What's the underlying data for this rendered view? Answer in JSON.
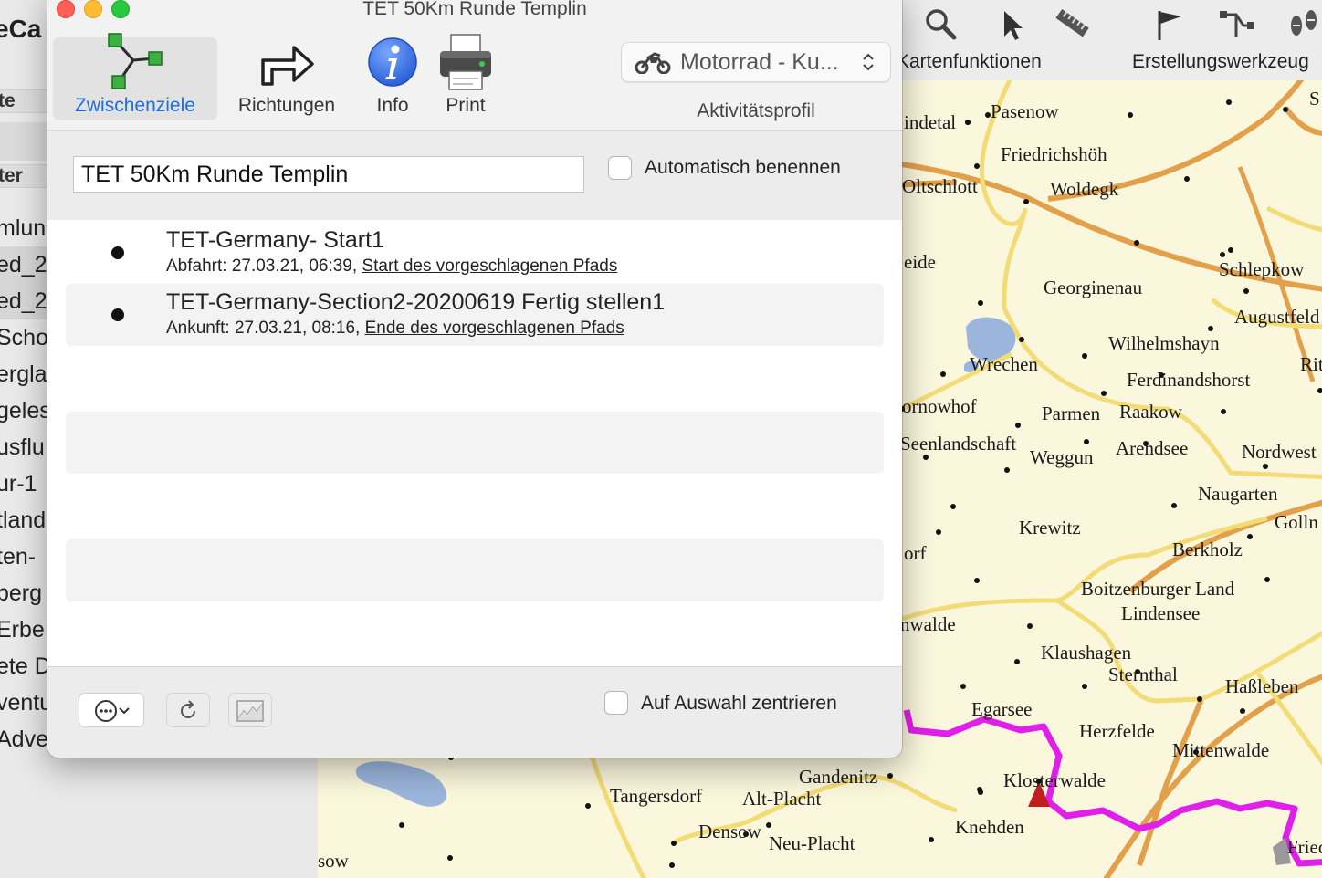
{
  "background_app": {
    "title_fragment": "eCa",
    "sidebar_header_1": "te",
    "sidebar_header_2": "ter",
    "sidebar_items": [
      "mlung",
      "ed_2",
      "ed_2",
      "Scho",
      "ergla",
      "geles",
      "usflu",
      "ur-1",
      "tland",
      "ten-",
      "berg",
      "Erbe",
      "ete D",
      "ventu",
      "Adve"
    ],
    "toolbar": {
      "map_functions_label": "Kartenfunktionen",
      "creation_tools_label": "Erstellungswerkzeug"
    },
    "map_labels": [
      "Pasenow",
      "Friedrichshöh",
      "indetal",
      "Oltschlott",
      "Woldegk",
      "eide",
      "Schlepkow",
      "Georginenau",
      "Augustfeld",
      "Wilhelmshayn",
      "Wrechen",
      "Ferdinandshorst",
      "Rittga",
      "ornowhof",
      "Parmen",
      "Raakow",
      "Seenlandschaft",
      "Weggun",
      "Arendsee",
      "Nordwest",
      "Naugarten",
      "Krewitz",
      "Golln",
      "orf",
      "Berkholz",
      "Boitzenburger Land",
      "Lindensee",
      "nwalde",
      "Klaushagen",
      "Sternthal",
      "Haßleben",
      "Egarsee",
      "Herzfelde",
      "Mittenwalde",
      "Gandenitz",
      "Klosterwalde",
      "Tangersdorf",
      "Alt-Placht",
      "Densow",
      "Neu-Placht",
      "Knehden",
      "Fried",
      "sow",
      "S"
    ]
  },
  "dialog": {
    "title": "TET 50Km Runde Templin",
    "toolbar": {
      "waypoints_label": "Zwischenziele",
      "directions_label": "Richtungen",
      "info_label": "Info",
      "print_label": "Print"
    },
    "profile": {
      "value": "Motorrad - Ku...",
      "label": "Aktivitätsprofil"
    },
    "route_name": "TET 50Km Runde Templin",
    "auto_name_label": "Automatisch benennen",
    "waypoints": [
      {
        "name": "TET-Germany- Start1",
        "detail_prefix": "Abfahrt: 27.03.21, 06:39, ",
        "detail_link": "Start des vorgeschlagenen Pfads"
      },
      {
        "name": "TET-Germany-Section2-20200619 Fertig stellen1",
        "detail_prefix": "Ankunft: 27.03.21, 08:16, ",
        "detail_link": "Ende des vorgeschlagenen Pfads"
      }
    ],
    "center_on_selection_label": "Auf Auswahl zentrieren"
  },
  "colors": {
    "accent_blue": "#1d6ee0",
    "route_magenta": "#e020e8",
    "map_background": "#fbf7dd",
    "road_orange": "#e2a04a",
    "road_yellow": "#f3dc76"
  }
}
